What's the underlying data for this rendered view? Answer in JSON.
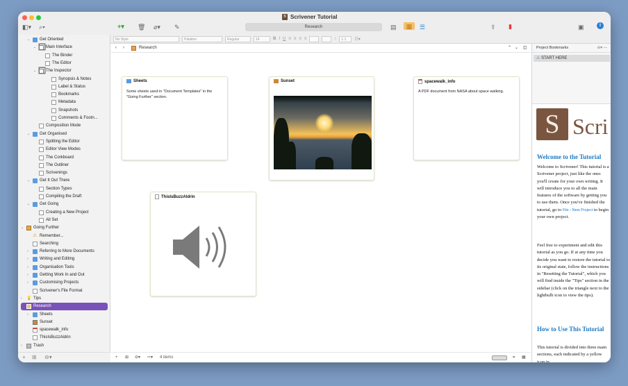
{
  "window": {
    "title": "Scrivener Tutorial"
  },
  "toolbar": {
    "search_label": "Research"
  },
  "format_bar": {
    "style": "No Style",
    "font": "Palatino",
    "weight": "Regular",
    "size": "14",
    "bold": "B",
    "italic": "I",
    "underline": "U",
    "line_spacing": "1.1"
  },
  "binder": {
    "items": [
      {
        "label": "Get Oriented",
        "level": 1,
        "icon": "folder",
        "chevron": "down"
      },
      {
        "label": "Main Interface",
        "level": 2,
        "icon": "stack",
        "chevron": "down"
      },
      {
        "label": "The Binder",
        "level": 3,
        "icon": "page"
      },
      {
        "label": "The Editor",
        "level": 3,
        "icon": "page"
      },
      {
        "label": "The Inspector",
        "level": 2,
        "icon": "stack",
        "chevron": "down"
      },
      {
        "label": "Synopsis & Notes",
        "level": 4,
        "icon": "page"
      },
      {
        "label": "Label & Status",
        "level": 4,
        "icon": "page"
      },
      {
        "label": "Bookmarks",
        "level": 4,
        "icon": "page"
      },
      {
        "label": "Metadata",
        "level": 4,
        "icon": "page"
      },
      {
        "label": "Snapshots",
        "level": 4,
        "icon": "page"
      },
      {
        "label": "Comments & Footn...",
        "level": 4,
        "icon": "page"
      },
      {
        "label": "Composition Mode",
        "level": 2,
        "icon": "page"
      },
      {
        "label": "Get Organised",
        "level": 1,
        "icon": "folder",
        "chevron": "down"
      },
      {
        "label": "Splitting the Editor",
        "level": 2,
        "icon": "page"
      },
      {
        "label": "Editor View Modes",
        "level": 2,
        "icon": "page"
      },
      {
        "label": "The Corkboard",
        "level": 2,
        "icon": "page"
      },
      {
        "label": "The Outliner",
        "level": 2,
        "icon": "page"
      },
      {
        "label": "Scrivenings",
        "level": 2,
        "icon": "page"
      },
      {
        "label": "Get It Out There",
        "level": 1,
        "icon": "folder",
        "chevron": "down"
      },
      {
        "label": "Section Types",
        "level": 2,
        "icon": "page"
      },
      {
        "label": "Compiling the Draft",
        "level": 2,
        "icon": "page"
      },
      {
        "label": "Get Going",
        "level": 1,
        "icon": "folder",
        "chevron": "down"
      },
      {
        "label": "Creating a New Project",
        "level": 2,
        "icon": "page"
      },
      {
        "label": "All Set",
        "level": 2,
        "icon": "page"
      },
      {
        "label": "Going Further",
        "level": 0,
        "icon": "book",
        "chevron": "down"
      },
      {
        "label": "Remember...",
        "level": 1,
        "icon": "warning"
      },
      {
        "label": "Searching",
        "level": 1,
        "icon": "page"
      },
      {
        "label": "Referring to More Documents",
        "level": 1,
        "icon": "folder",
        "chevron": "right"
      },
      {
        "label": "Writing and Editing",
        "level": 1,
        "icon": "folder",
        "chevron": "right"
      },
      {
        "label": "Organisation Tools",
        "level": 1,
        "icon": "folder",
        "chevron": "right"
      },
      {
        "label": "Getting Work In and Out",
        "level": 1,
        "icon": "folder",
        "chevron": "right"
      },
      {
        "label": "Customising Projects",
        "level": 1,
        "icon": "folder",
        "chevron": "right"
      },
      {
        "label": "Scrivener's File Format",
        "level": 1,
        "icon": "page"
      },
      {
        "label": "Tips",
        "level": 0,
        "icon": "bulb",
        "chevron": "right"
      },
      {
        "label": "Research",
        "level": 0,
        "icon": "research",
        "chevron": "down",
        "selected": true
      },
      {
        "label": "Sheets",
        "level": 1,
        "icon": "folder",
        "chevron": "right"
      },
      {
        "label": "Sunset",
        "level": 1,
        "icon": "image"
      },
      {
        "label": "spacewalk_info",
        "level": 1,
        "icon": "pdf"
      },
      {
        "label": "ThisIsBuzzAldrin",
        "level": 1,
        "icon": "audio"
      },
      {
        "label": "Trash",
        "level": 0,
        "icon": "trash",
        "chevron": "right"
      }
    ]
  },
  "editor": {
    "breadcrumb": "Research",
    "cards": [
      {
        "title": "Sheets",
        "body": "Some sheets used in \"Document Templates\" in the \"Going Further\" section."
      },
      {
        "title": "Sunset",
        "body": ""
      },
      {
        "title": "spacewalk_info",
        "body": "A PDF document from NASA about space walking."
      },
      {
        "title": "ThisIsBuzzAldrin",
        "body": ""
      }
    ],
    "footer_count": "4 items"
  },
  "inspector": {
    "header": "Project Bookmarks",
    "bookmark": "START HERE",
    "logo_letter": "S",
    "logo_text": "Scri",
    "h1": "Welcome to the Tutorial",
    "p1a": "Welcome to Scrivener! This tutorial is a Scrivener project, just like the ones you'll create for your own writing. It will introduce you to all the main features of the software by getting you to use them. Once you've finished the tutorial, go to ",
    "p1link": "File › New Project",
    "p1b": " to begin your own project.",
    "p2": "Feel free to experiment and edit this tutorial as you go. If at any time you decide you want to restore the tutorial to its original state, follow the instructions in \"Resetting the Tutorial\", which you will find inside the \"Tips\" section in the sidebar (click on the triangle next to the lightbulb icon to view the tips).",
    "h2": "How to Use This Tutorial",
    "p3": "This tutorial is divided into three main sections, each indicated by a yellow icon in"
  },
  "colors": {
    "selection": "#7a53b9",
    "link": "#1f7bc4",
    "logo": "#7a5641",
    "background": "#7d9cc4"
  }
}
